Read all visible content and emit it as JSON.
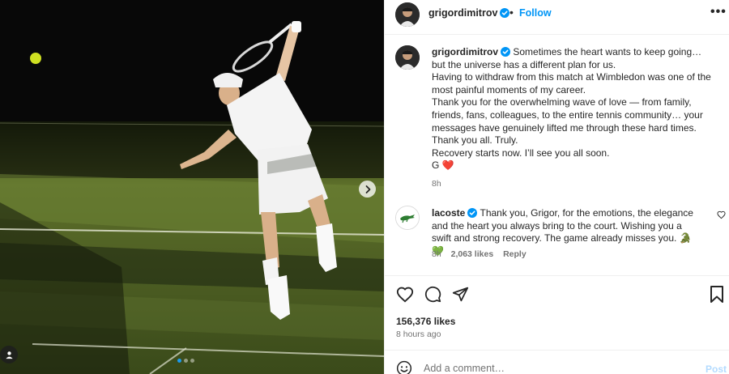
{
  "post": {
    "username": "grigordimitrov",
    "follow_label": "Follow",
    "separator": "•",
    "more_label": "•••"
  },
  "caption": {
    "username": "grigordimitrov",
    "lines": [
      "Sometimes the heart wants to keep going… but the universe has a different plan for us.",
      "Having to withdraw from this match at Wimbledon was one of the most painful moments of my career.",
      "Thank you for the overwhelming wave of love — from family, friends, fans, colleagues, to the entire tennis community… your messages have genuinely lifted me through these hard times.",
      "Thank you all. Truly.",
      "Recovery starts now. I’ll see you all soon.",
      "G ❤️"
    ],
    "time": "8h"
  },
  "comment": {
    "username": "lacoste",
    "text": "Thank you, Grigor, for the emotions, the elegance and the heart you always bring to the court. Wishing you a swift and strong recovery. The game already misses you. 🐊💚",
    "time": "8h",
    "likes": "2,063 likes",
    "reply_label": "Reply"
  },
  "stats": {
    "likes": "156,376 likes",
    "ago": "8 hours ago"
  },
  "composer": {
    "placeholder": "Add a comment…",
    "post_label": "Post"
  },
  "carousel": {
    "slides": 3,
    "active": 0
  },
  "colors": {
    "accent": "#0095f6",
    "verified": "#0095f6",
    "heart": "#ed4956",
    "post_disabled": "#b3dbff"
  }
}
